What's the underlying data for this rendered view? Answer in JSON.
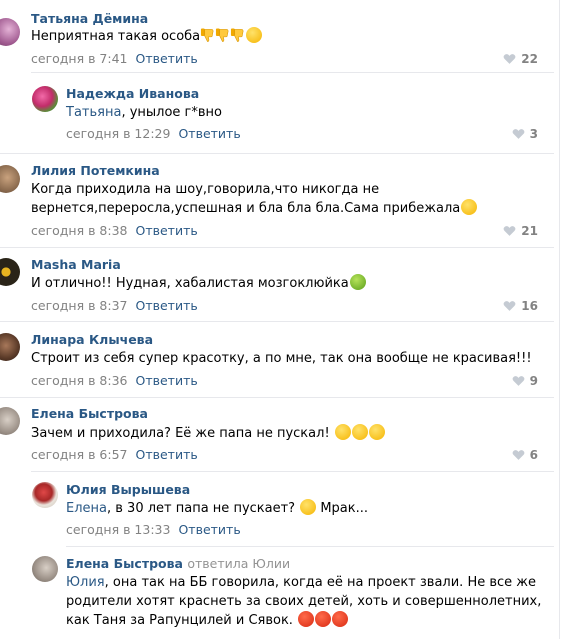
{
  "comments": [
    {
      "author": "Татьяна Дёмина",
      "text": "Неприятная такая особа",
      "emojis": [
        "thumbs-down-emoji",
        "thumbs-down-emoji",
        "thumbs-down-emoji",
        "relieved-face-emoji"
      ],
      "time": "сегодня в 7:41",
      "reply_label": "Ответить",
      "likes": "22"
    },
    {
      "author": "Надежда Иванова",
      "reply_to": "Татьяна",
      "text": ", унылое г*вно",
      "time": "сегодня в 12:29",
      "reply_label": "Ответить",
      "likes": "3"
    },
    {
      "author": "Лилия Потемкина",
      "text_line1": "Когда приходила на шоу,говорила,что никогда не",
      "text_line2": "вернется,переросла,успешная и бла бла бла.Сама прибежала",
      "emojis": [
        "tears-of-joy-emoji"
      ],
      "time": "сегодня в 8:38",
      "reply_label": "Ответить",
      "likes": "21"
    },
    {
      "author": "Masha Maria",
      "text": "И отлично!! Нудная, хабалистая мозгоклюйка",
      "emojis": [
        "nauseated-face-emoji"
      ],
      "time": "сегодня в 8:37",
      "reply_label": "Ответить",
      "likes": "16"
    },
    {
      "author": "Линара Клычева",
      "text": "Строит из себя супер красотку, а по мне, так она вообще не красивая!!!",
      "time": "сегодня в 8:36",
      "reply_label": "Ответить",
      "likes": "9"
    },
    {
      "author": "Елена Быстрова",
      "text": "Зачем и приходила? Её же папа не пускал! ",
      "emojis": [
        "relieved-face-emoji",
        "relieved-face-emoji",
        "relieved-face-emoji"
      ],
      "time": "сегодня в 6:57",
      "reply_label": "Ответить",
      "likes": "6"
    },
    {
      "author": "Юлия Вырышева",
      "reply_to": "Елена",
      "text": ", в 30 лет папа не пускает? ",
      "text_after": " Мрак...",
      "emojis": [
        "grimacing-face-emoji"
      ],
      "time": "сегодня в 13:33",
      "reply_label": "Ответить"
    },
    {
      "author": "Елена Быстрова",
      "author_verb": "ответила Юлии",
      "reply_to": "Юлия",
      "text_line1": ", она так на ББ говорила, когда её на проект звали. Не все же",
      "text_line2": "родители хотят краснеть за своих детей, хоть и совершеннолетних,",
      "text_line3": "как Таня за Рапунцилей и Сявок. ",
      "emojis": [
        "angry-face-emoji",
        "angry-face-emoji",
        "angry-face-emoji"
      ]
    }
  ],
  "icons": {
    "like": "heart-icon"
  },
  "colors": {
    "link": "#2a5885",
    "meta": "#828282",
    "divider": "#e7e8ec"
  }
}
